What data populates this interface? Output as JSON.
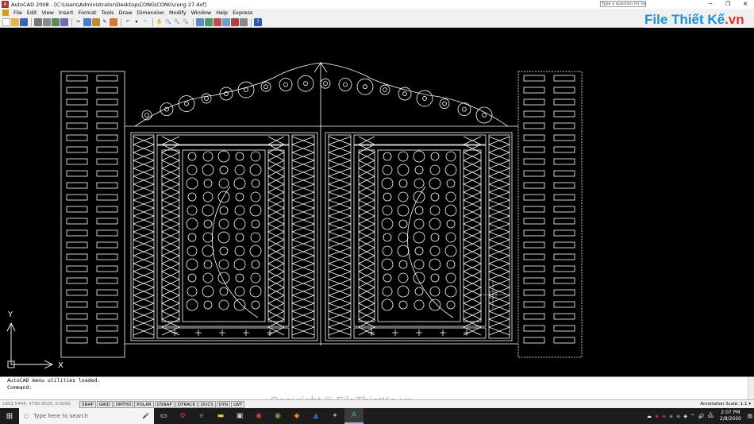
{
  "window": {
    "title": "AutoCAD 2008 - [C:\\Users\\Administrator\\Desktop\\CONG\\CONG\\cong 27.dxf]",
    "help_placeholder": "Type a question for help"
  },
  "menu": [
    "File",
    "Edit",
    "View",
    "Insert",
    "Format",
    "Tools",
    "Draw",
    "Dimension",
    "Modify",
    "Window",
    "Help",
    "Express"
  ],
  "logo": {
    "text_main": "File Thiết Kế",
    "text_suffix": ".vn"
  },
  "axis": {
    "x_label": "X",
    "y_label": "Y"
  },
  "command": {
    "history": "AutoCAD menu utilities loaded.",
    "prompt": "Command:"
  },
  "status": {
    "coords": "1891.5444, 4790.9520, 0.0000",
    "toggles": [
      "SNAP",
      "GRID",
      "ORTHO",
      "POLAR",
      "OSNAP",
      "OTRACK",
      "DUCS",
      "DYN",
      "LWT"
    ],
    "annotation_scale": "Annotation Scale: 1:1 ▾"
  },
  "taskbar": {
    "search_placeholder": "Type here to search",
    "time": "2:07 PM",
    "date": "2/8/2020"
  },
  "watermark": "Copyright © FileThietKe.vn",
  "colors": {
    "canvas": "#000000",
    "lines": "#ffffff",
    "logo": "#1a8fd6"
  }
}
